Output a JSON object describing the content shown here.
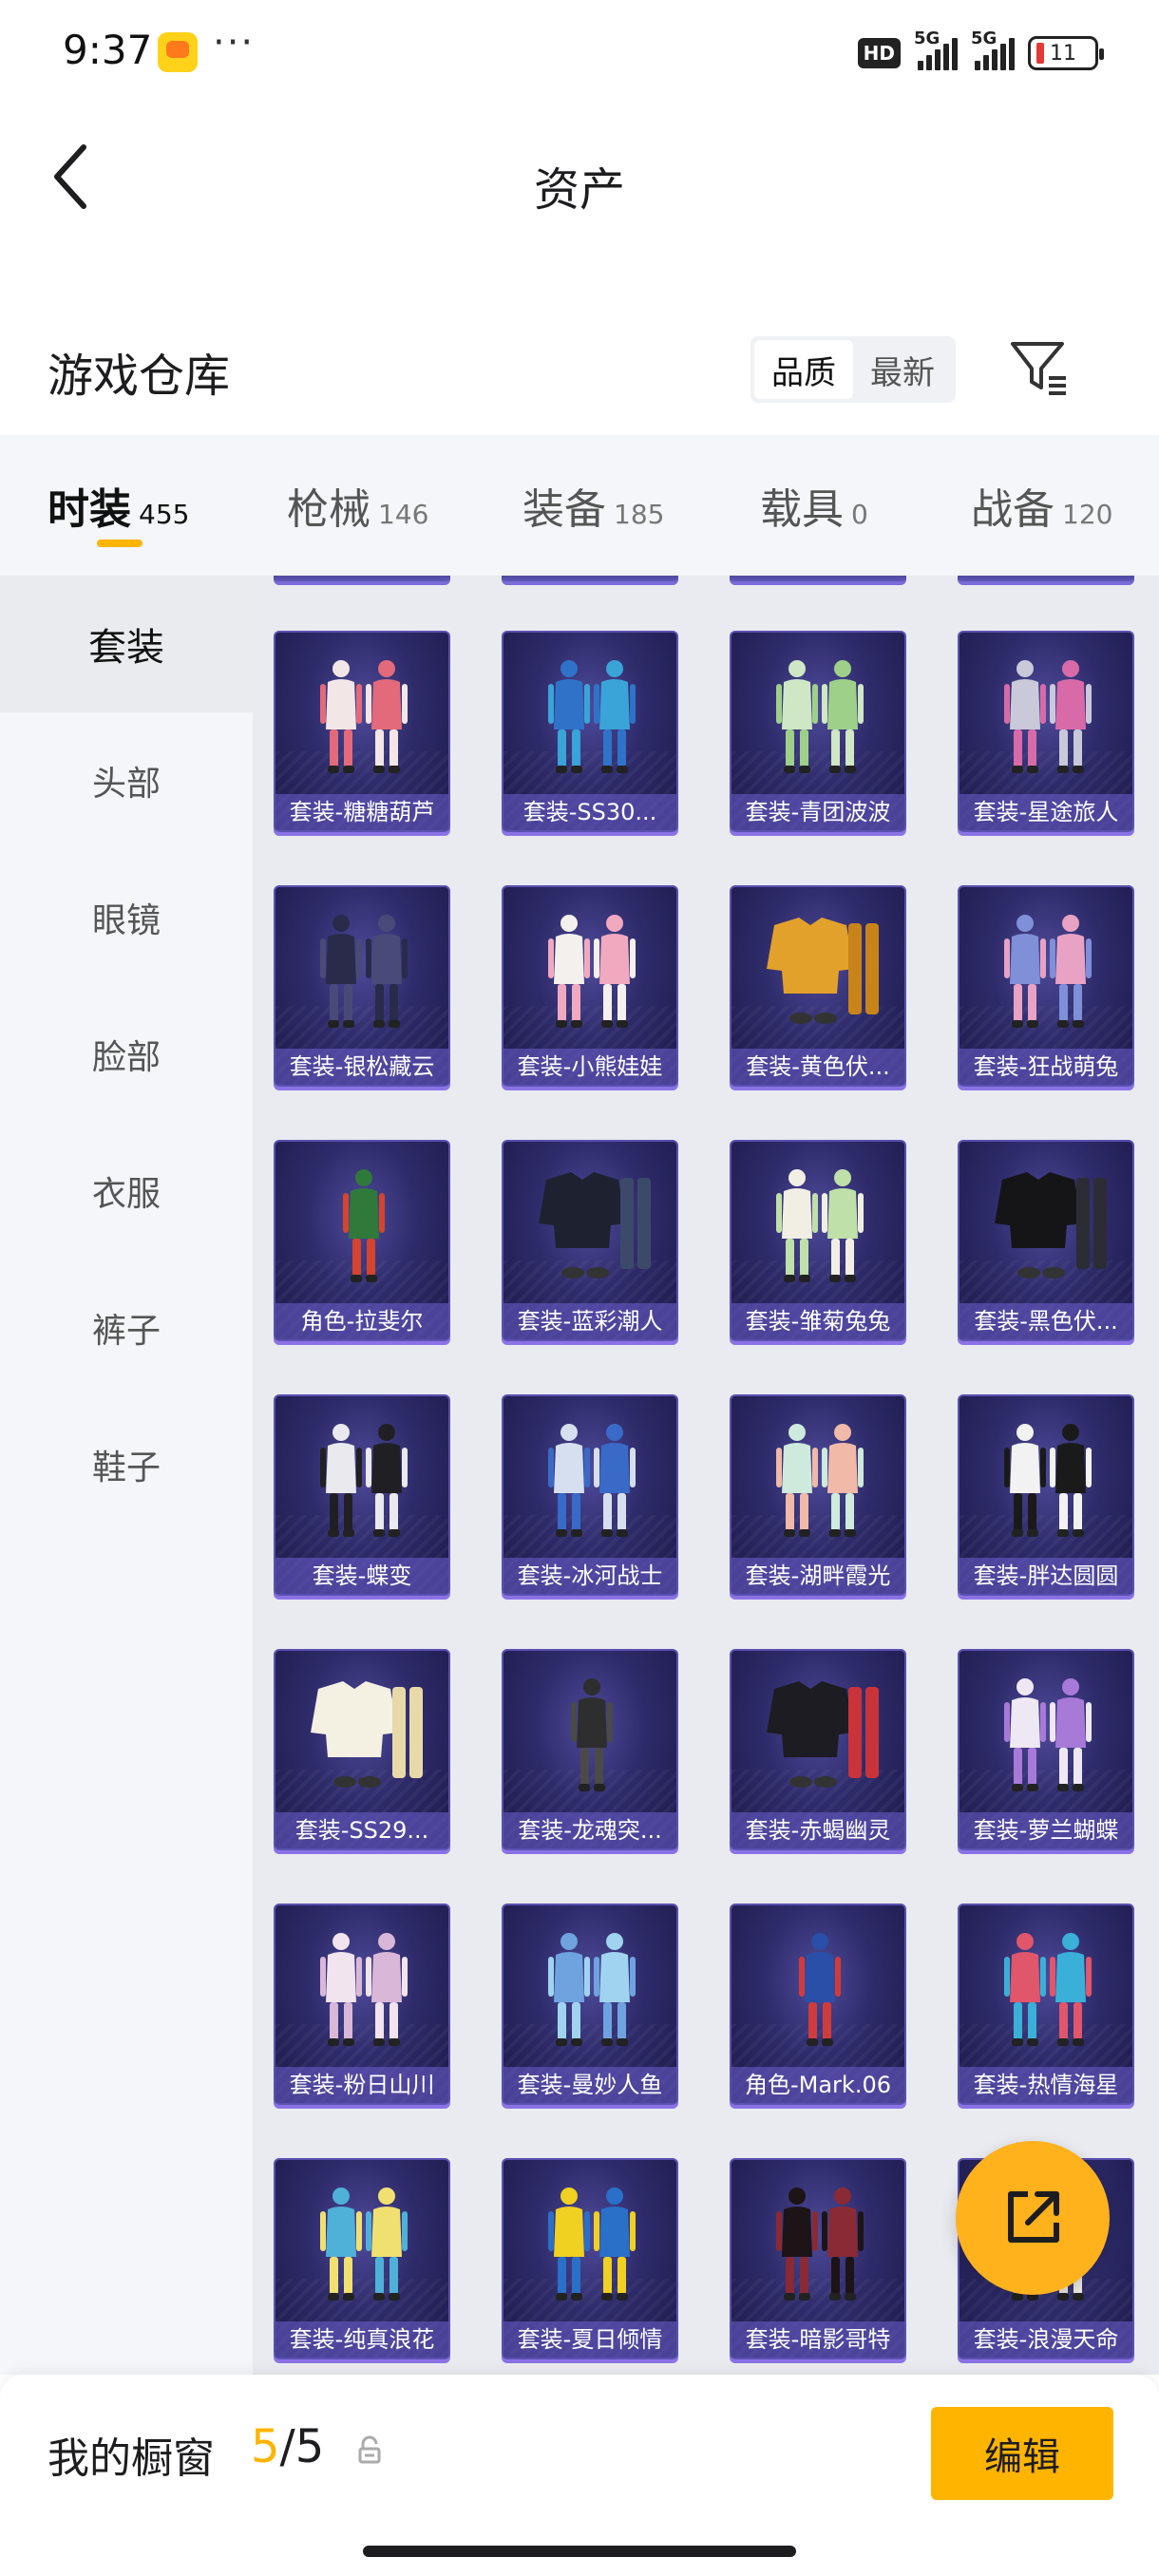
{
  "status_bar": {
    "time": "9:37",
    "app_icon": "game-assistant-app-icon",
    "more": "···",
    "hd_label": "HD",
    "signal_1_label": "5G",
    "signal_2_label": "5G",
    "battery_level": "11"
  },
  "header": {
    "back_icon": "chevron-left-icon",
    "title": "资产"
  },
  "warehouse": {
    "title": "游戏仓库",
    "sort_options": [
      "品质",
      "最新"
    ],
    "sort_selected": "品质",
    "filter_icon": "filter-icon"
  },
  "tabs": [
    {
      "label": "时装",
      "count": "455",
      "active": true
    },
    {
      "label": "枪械",
      "count": "146",
      "active": false
    },
    {
      "label": "装备",
      "count": "185",
      "active": false
    },
    {
      "label": "载具",
      "count": "0",
      "active": false
    },
    {
      "label": "战备",
      "count": "120",
      "active": false
    }
  ],
  "sidebar": {
    "items": [
      {
        "label": "套装",
        "active": true
      },
      {
        "label": "头部",
        "active": false
      },
      {
        "label": "眼镜",
        "active": false
      },
      {
        "label": "脸部",
        "active": false
      },
      {
        "label": "衣服",
        "active": false
      },
      {
        "label": "裤子",
        "active": false
      },
      {
        "label": "鞋子",
        "active": false
      }
    ]
  },
  "items": [
    {
      "label": "套装-糖糖葫芦",
      "colors": [
        "#f3e6e6",
        "#e26a7a"
      ],
      "kind": "pair"
    },
    {
      "label": "套装-SS30...",
      "colors": [
        "#2f73c9",
        "#3aa3d8"
      ],
      "kind": "pair"
    },
    {
      "label": "套装-青团波波",
      "colors": [
        "#cfe7c4",
        "#9fd08a"
      ],
      "kind": "pair"
    },
    {
      "label": "套装-星途旅人",
      "colors": [
        "#c9c9d9",
        "#d86aa8"
      ],
      "kind": "pair"
    },
    {
      "label": "套装-银松藏云",
      "colors": [
        "#2a2b4a",
        "#4a4a78"
      ],
      "kind": "pair"
    },
    {
      "label": "套装-小熊娃娃",
      "colors": [
        "#f4f0ee",
        "#f1a9c0"
      ],
      "kind": "pair"
    },
    {
      "label": "套装-黄色伏...",
      "colors": [
        "#e2a12a",
        "#c88418"
      ],
      "kind": "garment"
    },
    {
      "label": "套装-狂战萌兔",
      "colors": [
        "#7f8fd8",
        "#e7a2c4"
      ],
      "kind": "pair"
    },
    {
      "label": "角色-拉斐尔",
      "colors": [
        "#2f7a3a",
        "#d4442f"
      ],
      "kind": "single"
    },
    {
      "label": "套装-蓝彩潮人",
      "colors": [
        "#1e2230",
        "#3c4a6a"
      ],
      "kind": "garment"
    },
    {
      "label": "套装-雏菊兔兔",
      "colors": [
        "#f1efe4",
        "#bfe0a8"
      ],
      "kind": "pair"
    },
    {
      "label": "套装-黑色伏...",
      "colors": [
        "#151518",
        "#2c2c34"
      ],
      "kind": "garment"
    },
    {
      "label": "套装-蝶变",
      "colors": [
        "#e9e9ee",
        "#202024"
      ],
      "kind": "pair"
    },
    {
      "label": "套装-冰河战士",
      "colors": [
        "#d6dff0",
        "#3a6ac8"
      ],
      "kind": "pair"
    },
    {
      "label": "套装-湖畔霞光",
      "colors": [
        "#cdeadc",
        "#f0b9a8"
      ],
      "kind": "pair"
    },
    {
      "label": "套装-胖达圆圆",
      "colors": [
        "#f2f2f2",
        "#1a1a1a"
      ],
      "kind": "pair"
    },
    {
      "label": "套装-SS29...",
      "colors": [
        "#f4f0e2",
        "#e8d9a8"
      ],
      "kind": "garment"
    },
    {
      "label": "套装-龙魂突...",
      "colors": [
        "#2e2e2e",
        "#4a4a46"
      ],
      "kind": "single"
    },
    {
      "label": "套装-赤蝎幽灵",
      "colors": [
        "#1c1c22",
        "#c8343a"
      ],
      "kind": "garment"
    },
    {
      "label": "套装-萝兰蝴蝶",
      "colors": [
        "#ede8f4",
        "#a87ad8"
      ],
      "kind": "pair"
    },
    {
      "label": "套装-粉日山川",
      "colors": [
        "#f2e4ee",
        "#d9b7d8"
      ],
      "kind": "pair"
    },
    {
      "label": "套装-曼妙人鱼",
      "colors": [
        "#6fa3e0",
        "#9fd3f0"
      ],
      "kind": "pair"
    },
    {
      "label": "角色-Mark.06",
      "colors": [
        "#2a4fa8",
        "#d03c3c"
      ],
      "kind": "single"
    },
    {
      "label": "套装-热情海星",
      "colors": [
        "#e0566a",
        "#3ab0d8"
      ],
      "kind": "pair"
    },
    {
      "label": "套装-纯真浪花",
      "colors": [
        "#4fb0d8",
        "#f0e070"
      ],
      "kind": "pair"
    },
    {
      "label": "套装-夏日倾情",
      "colors": [
        "#f0d020",
        "#2a70c8"
      ],
      "kind": "pair"
    },
    {
      "label": "套装-暗影哥特",
      "colors": [
        "#1c1416",
        "#8a2a34"
      ],
      "kind": "pair"
    },
    {
      "label": "套装-浪漫天命",
      "colors": [
        "#f0ece4",
        "#d8c4a8"
      ],
      "kind": "pair"
    }
  ],
  "share_button": {
    "icon": "share-icon"
  },
  "bottom_bar": {
    "label": "我的橱窗",
    "count_current": "5",
    "count_separator": "/",
    "count_total": "5",
    "lock_icon": "lock-icon",
    "edit_label": "编辑"
  }
}
